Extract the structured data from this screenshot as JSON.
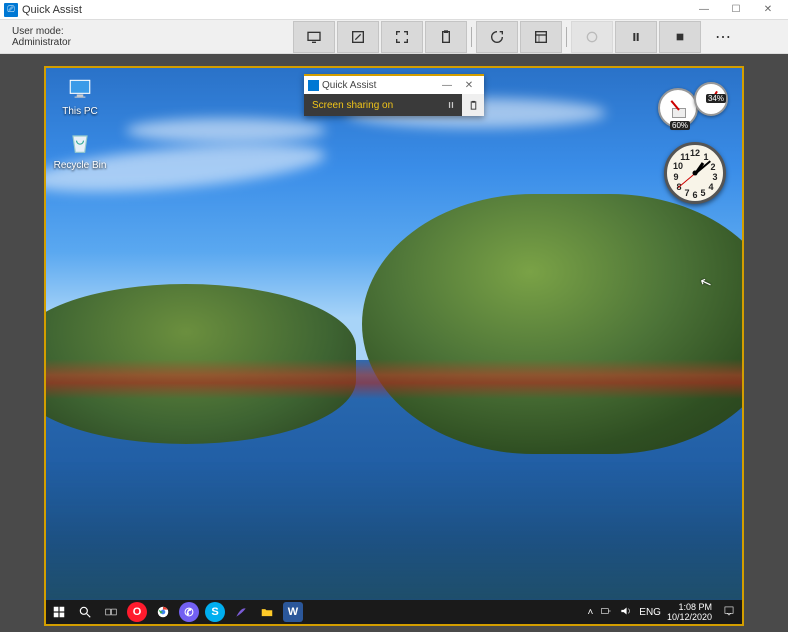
{
  "outer_window": {
    "title": "Quick Assist",
    "controls": {
      "minimize": "—",
      "maximize": "☐",
      "close": "✕"
    }
  },
  "user_mode": {
    "label": "User mode:",
    "value": "Administrator"
  },
  "toolbar": {
    "monitors": "monitors-icon",
    "annotate": "annotate-icon",
    "fit": "actual-size-icon",
    "instruction": "toggle-instruction-icon",
    "restart": "restart-icon",
    "taskmgr": "task-manager-icon",
    "reconnect": "reconnect-icon",
    "pause": "pause-icon",
    "end": "end-icon",
    "more": "⋯"
  },
  "remote": {
    "mini_bar": {
      "title": "Quick Assist",
      "status": "Screen sharing on",
      "controls": {
        "minimize": "—",
        "close": "✕"
      }
    },
    "desktop_icons": {
      "this_pc": "This PC",
      "recycle_bin": "Recycle Bin"
    },
    "gadgets": {
      "meter": {
        "cpu_pct": "60%",
        "ram_pct": "34%"
      },
      "clock": {
        "numbers": [
          "12",
          "1",
          "2",
          "3",
          "4",
          "5",
          "6",
          "7",
          "8",
          "9",
          "10",
          "11"
        ]
      }
    },
    "taskbar": {
      "start": "start",
      "search": "search",
      "taskview": "task-view",
      "apps": {
        "opera": "O",
        "chrome": "chrome",
        "viber": "viber",
        "skype": "S",
        "feather": "feather",
        "explorer": "explorer",
        "word": "W"
      },
      "tray": {
        "chevron": "^",
        "network": "net",
        "sound": "snd",
        "lang": "ENG",
        "time": "1:08 PM",
        "date": "10/12/2020",
        "notifications": "notif"
      }
    }
  }
}
